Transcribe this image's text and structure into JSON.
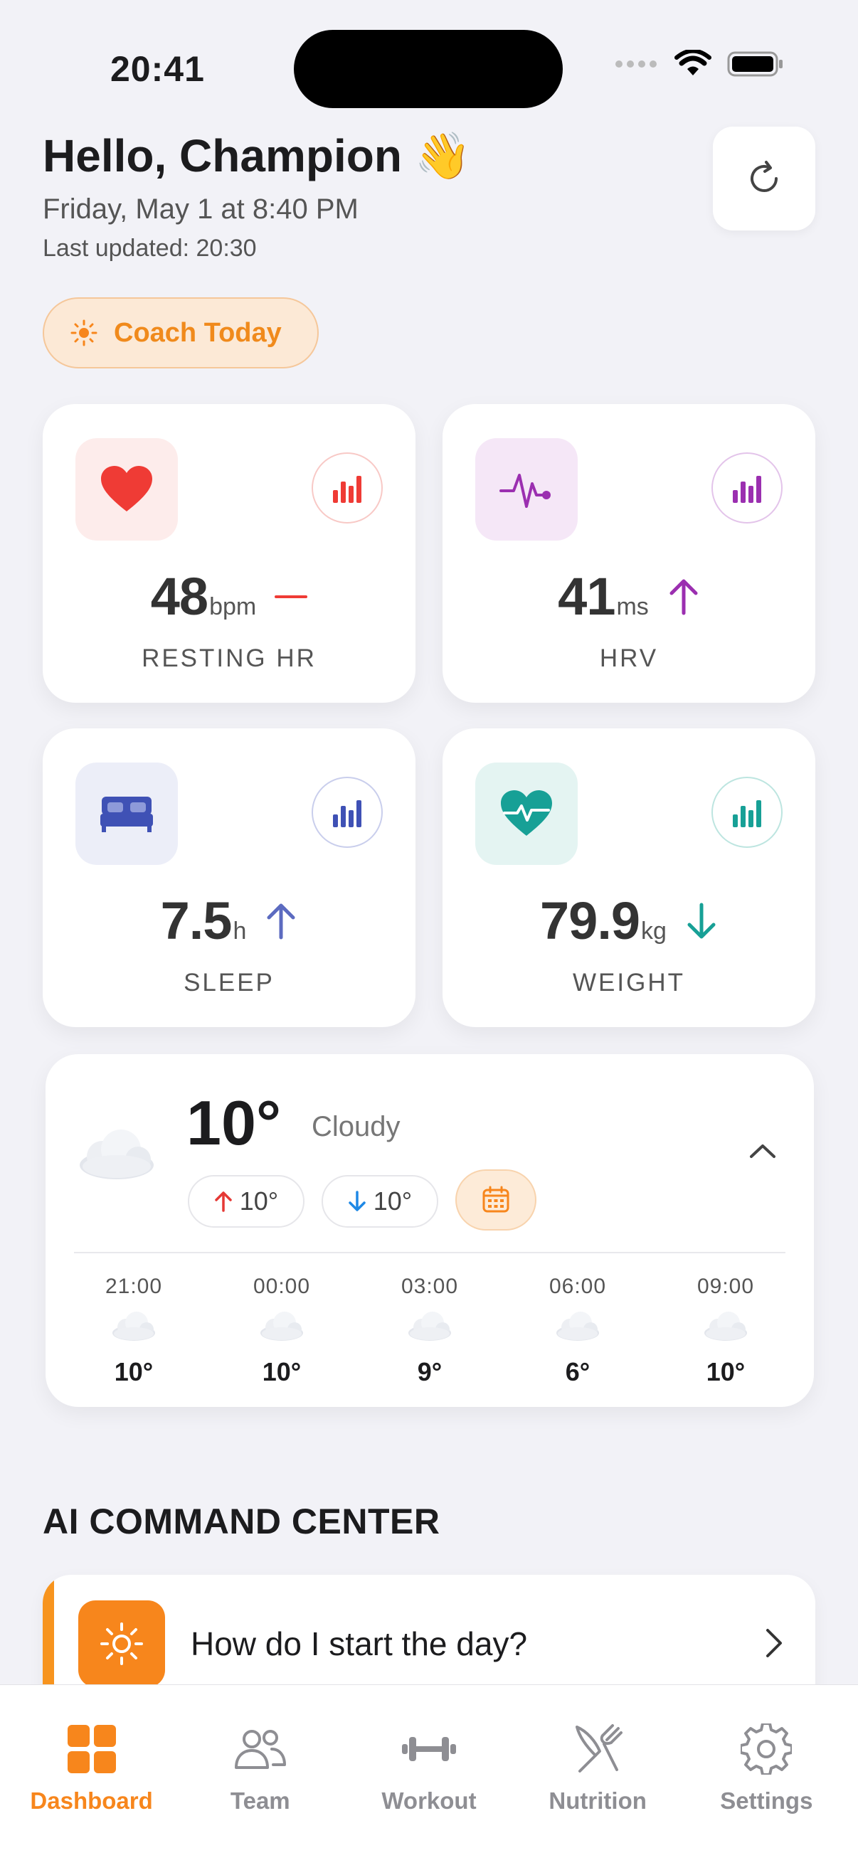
{
  "status_bar": {
    "time": "20:41"
  },
  "header": {
    "greeting": "Hello, Champion 👋",
    "date": "Friday, May 1 at 8:40 PM",
    "last_updated": "Last updated: 20:30"
  },
  "coach_button": {
    "label": "Coach Today"
  },
  "metrics": [
    {
      "value": "48",
      "unit": "bpm",
      "label": "RESTING HR",
      "trend": "flat",
      "accent": "#EF3B35"
    },
    {
      "value": "41",
      "unit": "ms",
      "label": "HRV",
      "trend": "up",
      "accent": "#9B2FB0"
    },
    {
      "value": "7.5",
      "unit": "h",
      "label": "SLEEP",
      "trend": "up",
      "accent": "#3F51B5"
    },
    {
      "value": "79.9",
      "unit": "kg",
      "label": "WEIGHT",
      "trend": "down",
      "accent": "#17A096"
    }
  ],
  "weather": {
    "temperature": "10°",
    "condition": "Cloudy",
    "high": "10°",
    "low": "10°",
    "hourly": [
      {
        "time": "21:00",
        "temp": "10°"
      },
      {
        "time": "00:00",
        "temp": "10°"
      },
      {
        "time": "03:00",
        "temp": "9°"
      },
      {
        "time": "06:00",
        "temp": "6°"
      },
      {
        "time": "09:00",
        "temp": "10°"
      }
    ]
  },
  "ai_command_center": {
    "title": "AI COMMAND CENTER",
    "items": [
      {
        "label": "How do I start the day?"
      }
    ]
  },
  "tab_bar": {
    "active": "Dashboard",
    "accent": "#F7861C",
    "tabs": [
      {
        "label": "Dashboard",
        "icon": "grid-icon"
      },
      {
        "label": "Team",
        "icon": "people-icon"
      },
      {
        "label": "Workout",
        "icon": "dumbbell-icon"
      },
      {
        "label": "Nutrition",
        "icon": "fork-knife-icon"
      },
      {
        "label": "Settings",
        "icon": "gear-icon"
      }
    ]
  }
}
